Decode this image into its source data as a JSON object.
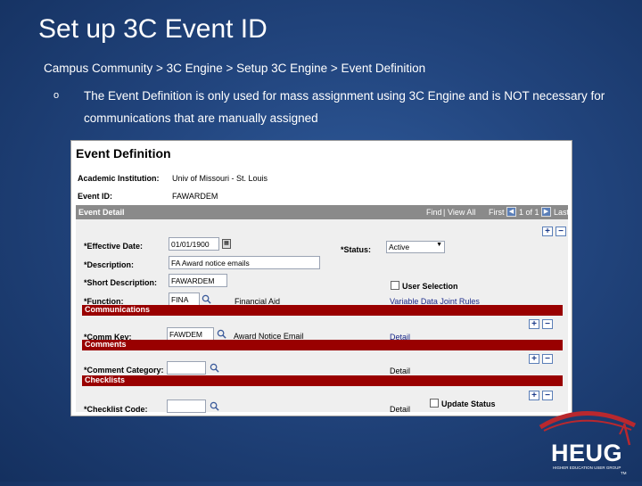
{
  "slide": {
    "title": "Set up 3C Event ID",
    "breadcrumb": "Campus Community > 3C Engine > Setup 3C Engine > Event Definition",
    "bullet_mark": "o",
    "bullet_text": "The Event Definition is only used for mass assignment using 3C Engine and is NOT necessary for communications that are manually assigned"
  },
  "panel": {
    "title": "Event Definition",
    "academic_institution_label": "Academic Institution:",
    "academic_institution_value": "Univ of Missouri - St. Louis",
    "event_id_label": "Event ID:",
    "event_id_value": "FAWARDEM",
    "detail_bar": {
      "title": "Event Detail",
      "find": "Find",
      "view_all": "View All",
      "first": "First",
      "count": "1 of 1",
      "last": "Last"
    },
    "fields": {
      "effective_date_label": "*Effective Date:",
      "effective_date_value": "01/01/1900",
      "status_label": "*Status:",
      "status_value": "Active",
      "description_label": "*Description:",
      "description_value": "FA Award notice emails",
      "short_description_label": "*Short Description:",
      "short_description_value": "FAWARDEM",
      "user_selection_label": "User Selection",
      "function_label": "*Function:",
      "function_value": "FINA",
      "function_desc": "Financial Aid",
      "variable_data_link": "Variable Data Joint Rules"
    },
    "communications": {
      "header": "Communications",
      "comm_key_label": "*Comm Key:",
      "comm_key_value": "FAWDEM",
      "comm_key_desc": "Award Notice Email",
      "detail_link": "Detail"
    },
    "comments": {
      "header": "Comments",
      "category_label": "*Comment Category:",
      "category_value": "",
      "detail": "Detail"
    },
    "checklists": {
      "header": "Checklists",
      "code_label": "*Checklist Code:",
      "code_value": "",
      "update_status_label": "Update Status",
      "detail": "Detail"
    }
  },
  "logo": {
    "text": "HEUG",
    "subtext": "HIGHER EDUCATION USER GROUP",
    "tm": "TM"
  },
  "colors": {
    "section_red": "#990000",
    "detail_bar_gray": "#8a8a8a",
    "background_blue": "#22457e"
  }
}
